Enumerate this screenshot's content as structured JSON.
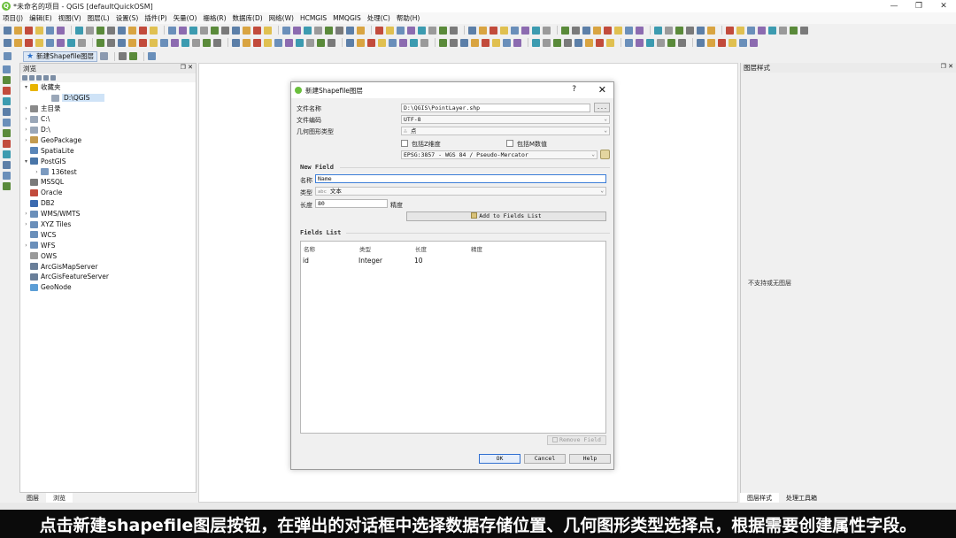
{
  "window": {
    "title": "*未命名的项目 - QGIS [defaultQuickOSM]",
    "logo": "Q"
  },
  "menubar": [
    "项目(J)",
    "编辑(E)",
    "视图(V)",
    "图层(L)",
    "设置(S)",
    "插件(P)",
    "矢量(O)",
    "栅格(R)",
    "数据库(D)",
    "网络(W)",
    "HCMGIS",
    "MMQGIS",
    "处理(C)",
    "帮助(H)"
  ],
  "toolbar3": {
    "new_shapefile_label": "新建Shapefile图层"
  },
  "browser": {
    "title": "浏览",
    "items": [
      {
        "label": "收藏夹",
        "arrow": "▾",
        "icon": "star-icon",
        "level": 0,
        "color": "#e8b400"
      },
      {
        "label": "D:\\QGIS",
        "arrow": "",
        "icon": "folder-icon",
        "level": 2,
        "color": "#9aa7b8",
        "selected": true
      },
      {
        "label": "主目录",
        "arrow": "›",
        "icon": "home-icon",
        "level": 0,
        "color": "#8a8a8a"
      },
      {
        "label": "C:\\",
        "arrow": "›",
        "icon": "folder-icon",
        "level": 0,
        "color": "#9aa7b8"
      },
      {
        "label": "D:\\",
        "arrow": "›",
        "icon": "folder-icon",
        "level": 0,
        "color": "#9aa7b8"
      },
      {
        "label": "GeoPackage",
        "arrow": "›",
        "icon": "geopackage-icon",
        "level": 0,
        "color": "#c39b4f"
      },
      {
        "label": "SpatiaLite",
        "arrow": "",
        "icon": "spatialite-icon",
        "level": 0,
        "color": "#5a86b8"
      },
      {
        "label": "PostGIS",
        "arrow": "▾",
        "icon": "postgis-icon",
        "level": 0,
        "color": "#4a76a8"
      },
      {
        "label": "136test",
        "arrow": "›",
        "icon": "connection-icon",
        "level": 1,
        "color": "#7b9ac0"
      },
      {
        "label": "MSSQL",
        "arrow": "",
        "icon": "mssql-icon",
        "level": 0,
        "color": "#7a7a7a"
      },
      {
        "label": "Oracle",
        "arrow": "",
        "icon": "oracle-icon",
        "level": 0,
        "color": "#c24b3c"
      },
      {
        "label": "DB2",
        "arrow": "",
        "icon": "db2-icon",
        "level": 0,
        "color": "#3c6bb0"
      },
      {
        "label": "WMS/WMTS",
        "arrow": "›",
        "icon": "globe-icon",
        "level": 0,
        "color": "#6a8fba"
      },
      {
        "label": "XYZ Tiles",
        "arrow": "›",
        "icon": "tiles-icon",
        "level": 0,
        "color": "#6a8fba"
      },
      {
        "label": "WCS",
        "arrow": "",
        "icon": "globe-icon",
        "level": 0,
        "color": "#6a8fba"
      },
      {
        "label": "WFS",
        "arrow": "›",
        "icon": "globe-icon",
        "level": 0,
        "color": "#6a8fba"
      },
      {
        "label": "OWS",
        "arrow": "",
        "icon": "globe-icon",
        "level": 0,
        "color": "#9a9a9a"
      },
      {
        "label": "ArcGisMapServer",
        "arrow": "",
        "icon": "arcgis-icon",
        "level": 0,
        "color": "#6a7f99"
      },
      {
        "label": "ArcGisFeatureServer",
        "arrow": "",
        "icon": "arcgis-icon",
        "level": 0,
        "color": "#6a7f99"
      },
      {
        "label": "GeoNode",
        "arrow": "",
        "icon": "geonode-icon",
        "level": 0,
        "color": "#5c9ed6"
      }
    ],
    "tabs": [
      "图层",
      "浏览"
    ]
  },
  "style_panel": {
    "title": "图层样式",
    "message": "不支持或无图层",
    "tabs": [
      "图层样式",
      "处理工具箱"
    ]
  },
  "dialog": {
    "title": "新建Shapefile图层",
    "help": "?",
    "close": "✕",
    "file_name_label": "文件名称",
    "file_name_value": "D:\\QGIS\\PointLayer.shp",
    "browse_label": "...",
    "encoding_label": "文件编码",
    "encoding_value": "UTF-8",
    "geometry_label": "几何图形类型",
    "geometry_value": "点",
    "z_label": "包括Z维度",
    "m_label": "包括M数值",
    "crs_value": "EPSG:3857 - WGS 84 / Pseudo-Mercator",
    "new_field_title": "New Field",
    "name_label": "名称",
    "name_value": "Name",
    "type_label": "类型",
    "type_value": "文本",
    "type_prefix": "abc",
    "length_label": "长度",
    "length_value": "80",
    "precision_label": "精度",
    "add_field_label": "Add to Fields List",
    "fields_list_title": "Fields List",
    "columns": [
      "名称",
      "类型",
      "长度",
      "精度"
    ],
    "rows": [
      [
        "id",
        "Integer",
        "10",
        ""
      ]
    ],
    "remove_field_label": "Remove Field",
    "ok_label": "OK",
    "cancel_label": "Cancel",
    "help_label": "Help"
  },
  "subtitle": "点击新建shapefile图层按钮，在弹出的对话框中选择数据存储位置、几何图形类型选择点，根据需要创建属性字段。"
}
